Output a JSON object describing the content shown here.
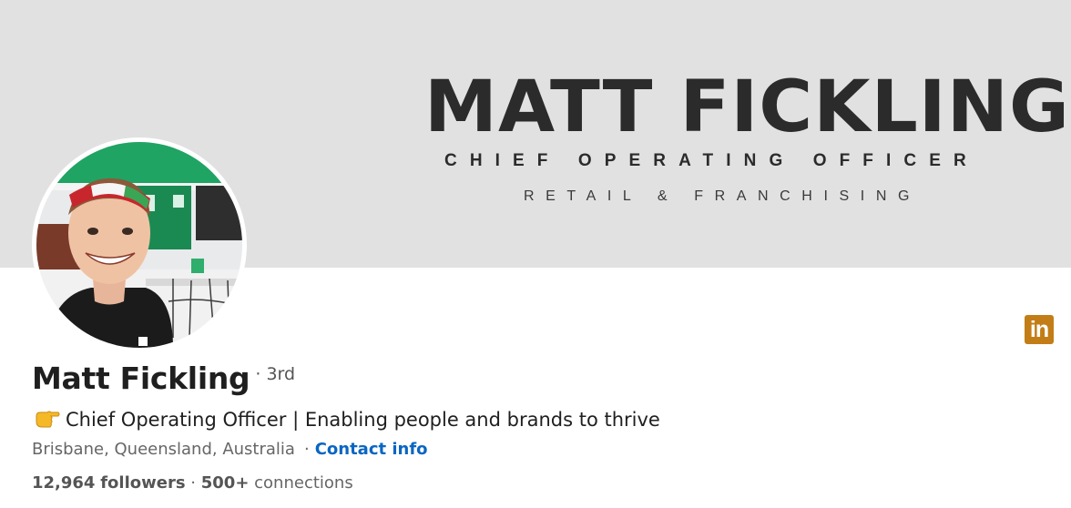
{
  "banner": {
    "title": "MATT FICKLING",
    "subtitle": "CHIEF OPERATING OFFICER",
    "tagline": "RETAIL & FRANCHISING",
    "background_color": "#e1e1e1",
    "text_color": "#2b2b2b"
  },
  "profile": {
    "name": "Matt Fickling",
    "degree": "· 3rd",
    "headline_icon": "pointing-hand-emoji-icon",
    "headline": "Chief Operating Officer | Enabling people and brands to thrive",
    "location": "Brisbane, Queensland, Australia",
    "separator": "·",
    "contact_label": "Contact info",
    "followers_count": "12,964",
    "followers_label": "followers",
    "dot": "·",
    "connections_count": "500+",
    "connections_label": "connections"
  },
  "linkedin_badge": {
    "icon": "linkedin-icon",
    "label": "in",
    "color": "#c37d16"
  },
  "colors": {
    "link": "#0a66c2",
    "muted_text": "#666666"
  }
}
